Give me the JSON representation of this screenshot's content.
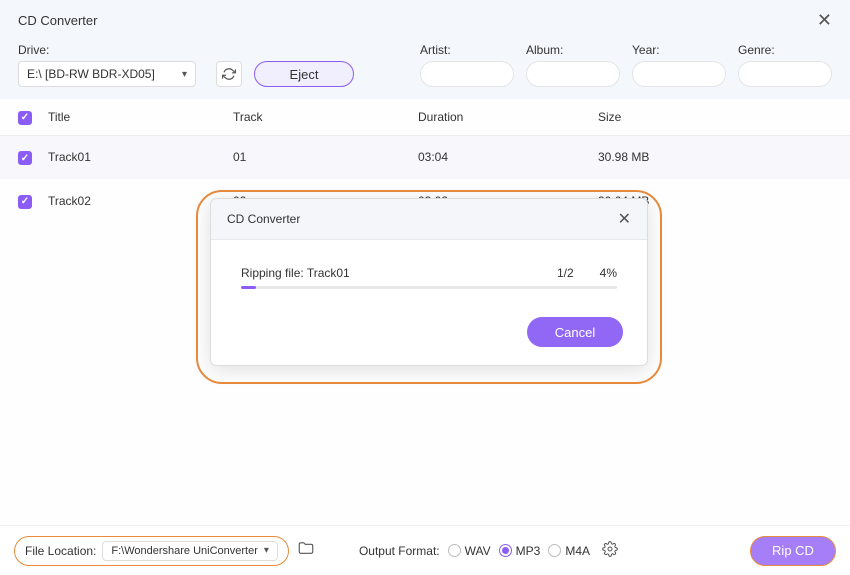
{
  "window": {
    "title": "CD Converter"
  },
  "drive": {
    "label": "Drive:",
    "selected": "E:\\ [BD-RW  BDR-XD05]",
    "eject": "Eject"
  },
  "meta": {
    "artist": {
      "label": "Artist:"
    },
    "album": {
      "label": "Album:"
    },
    "year": {
      "label": "Year:"
    },
    "genre": {
      "label": "Genre:"
    }
  },
  "columns": {
    "title": "Title",
    "track": "Track",
    "duration": "Duration",
    "size": "Size"
  },
  "tracks": [
    {
      "title": "Track01",
      "track": "01",
      "duration": "03:04",
      "size": "30.98 MB"
    },
    {
      "title": "Track02",
      "track": "02",
      "duration": "03:02",
      "size": "30.64 MB"
    }
  ],
  "modal": {
    "title": "CD Converter",
    "ripping": "Ripping file: Track01",
    "count": "1/2",
    "percent": "4%",
    "progress_pct": 4,
    "cancel": "Cancel"
  },
  "footer": {
    "file_location_label": "File Location:",
    "file_location_value": "F:\\Wondershare UniConverter",
    "output_label": "Output Format:",
    "formats": {
      "wav": "WAV",
      "mp3": "MP3",
      "m4a": "M4A"
    },
    "selected_format": "mp3",
    "rip": "Rip CD"
  }
}
